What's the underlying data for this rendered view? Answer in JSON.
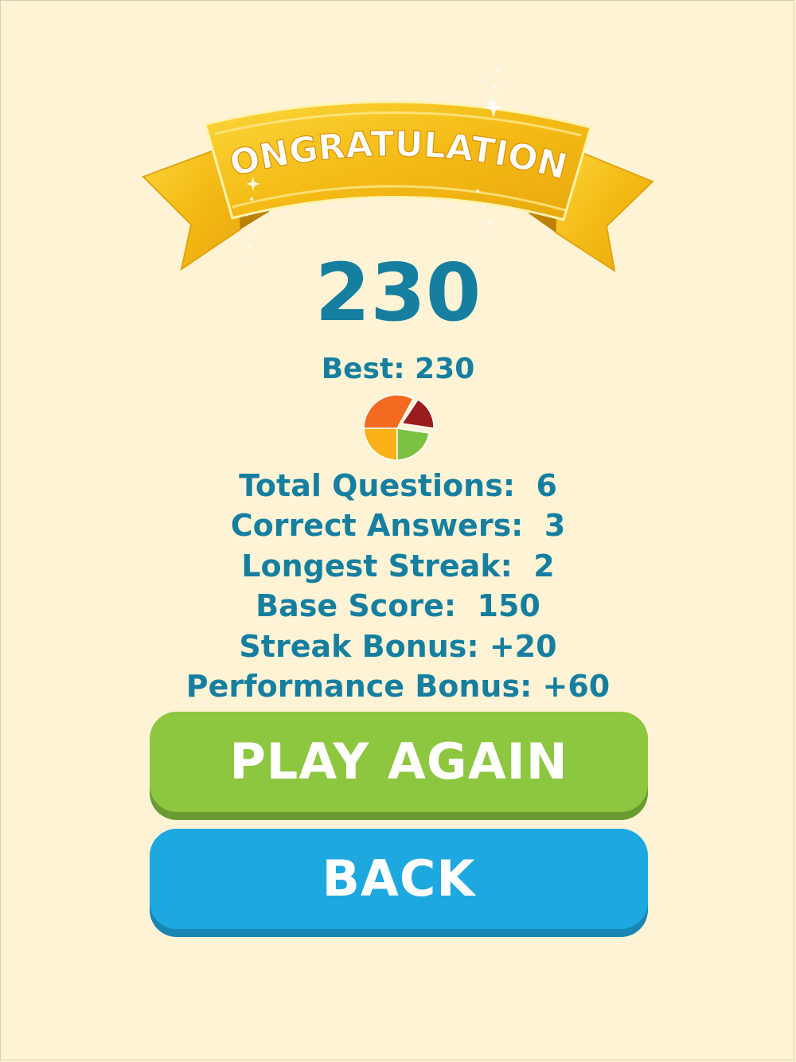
{
  "banner": {
    "title": "CONGRATULATIONS"
  },
  "score": {
    "value": "230",
    "best": "Best: 230"
  },
  "stats": [
    "Total Questions:  6",
    "Correct Answers:  3",
    "Longest Streak:  2",
    "Base Score:  150",
    "Streak Bonus: +20",
    "Performance Bonus: +60"
  ],
  "buttons": {
    "play_again": "PLAY AGAIN",
    "back": "BACK"
  },
  "icons": {
    "stats_pie": "pie-chart-icon"
  },
  "colors": {
    "background": "#fff3d6",
    "text": "#167f9f",
    "play_again": "#8dc63f",
    "back": "#1ea8e0",
    "banner_gold": "#f7c21c"
  }
}
